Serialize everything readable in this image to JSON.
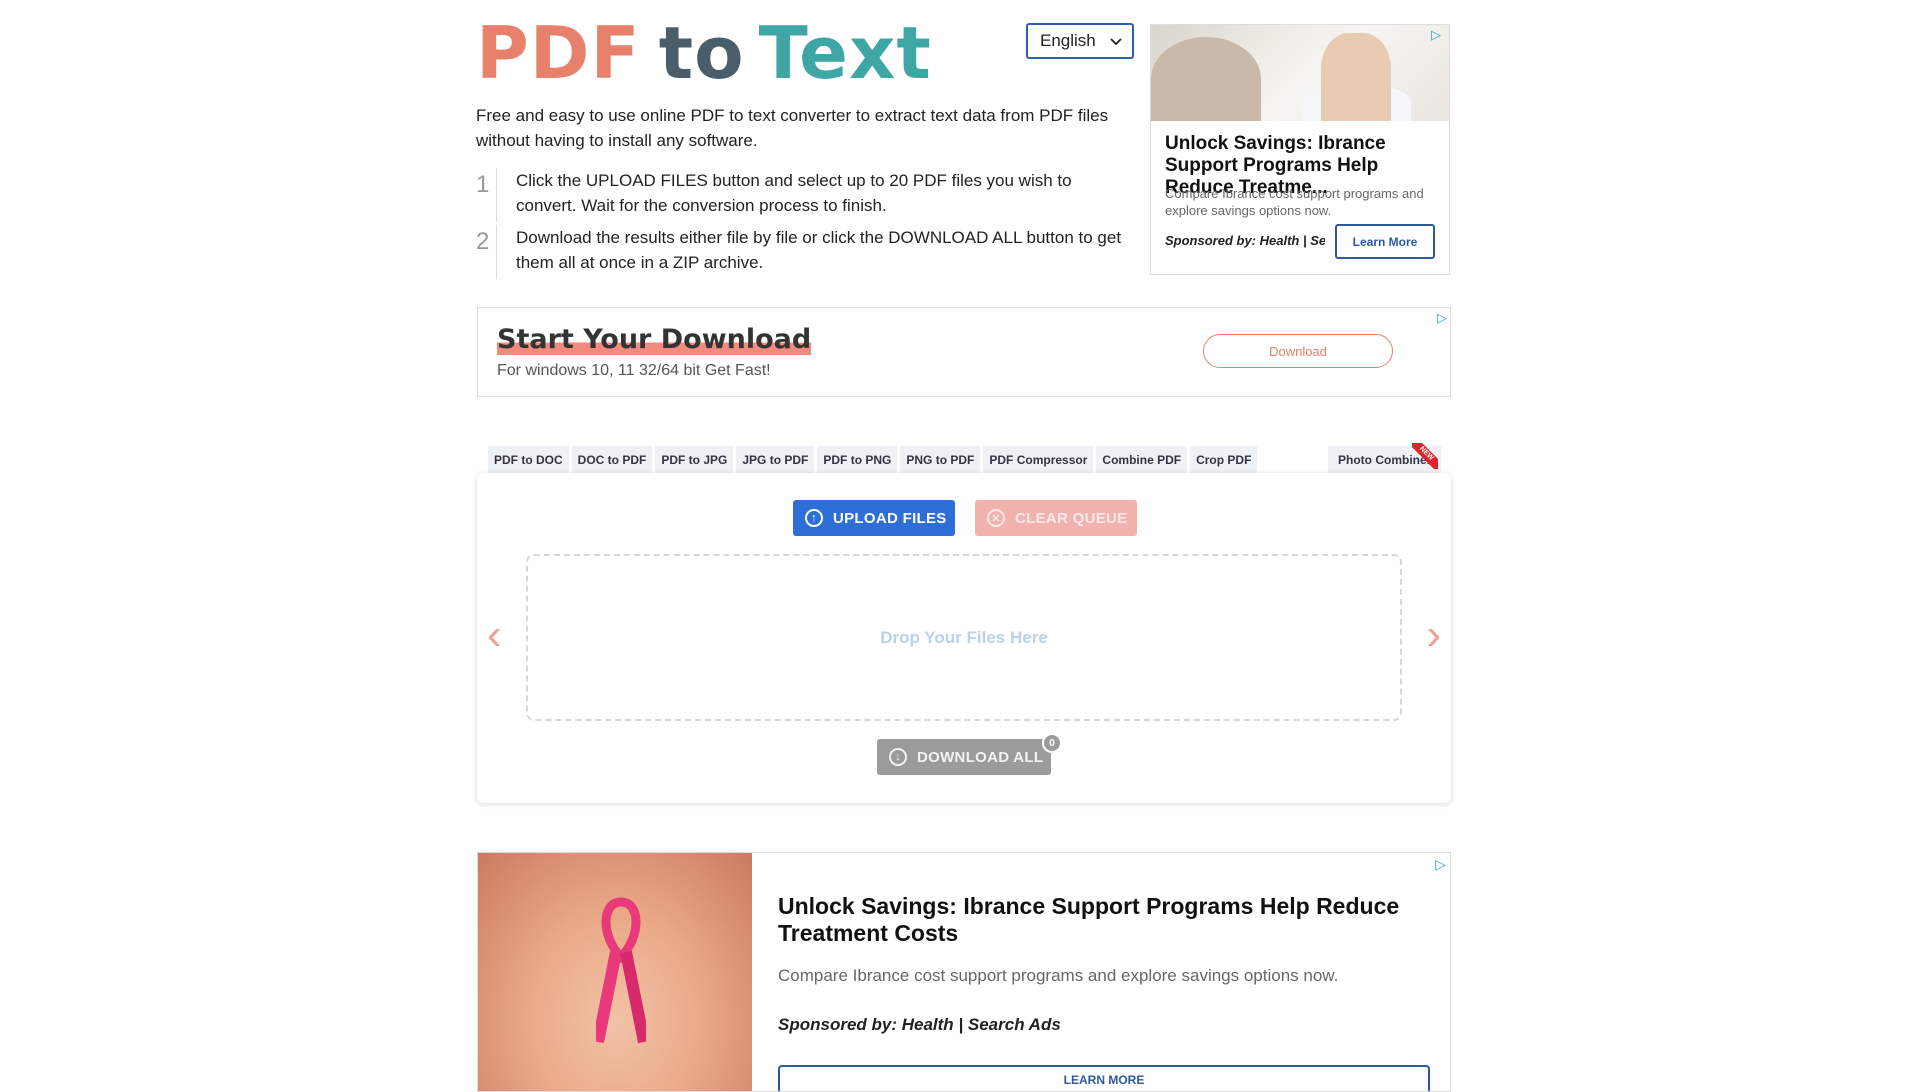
{
  "logo": {
    "part1": "PDF",
    "part2": "to",
    "part3": "Text"
  },
  "language": {
    "selected": "English"
  },
  "intro": "Free and easy to use online PDF to text converter to extract text data from PDF files without having to install any software.",
  "steps": [
    {
      "num": "1",
      "text": "Click the UPLOAD FILES button and select up to 20 PDF files you wish to convert. Wait for the conversion process to finish."
    },
    {
      "num": "2",
      "text": "Download the results either file by file or click the DOWNLOAD ALL button to get them all at once in a ZIP archive."
    }
  ],
  "ad_right": {
    "title": "Unlock Savings: Ibrance Support Programs Help Reduce Treatme...",
    "desc": "Compare Ibrance cost support programs and explore savings options now.",
    "sponsor": "Sponsored by: Health | Sea...",
    "button": "Learn More"
  },
  "ad_banner": {
    "headline": "Start Your Download",
    "sub": "For windows 10, 11 32/64 bit Get Fast!",
    "button": "Download"
  },
  "tabs": [
    "PDF to DOC",
    "DOC to PDF",
    "PDF to JPG",
    "JPG to PDF",
    "PDF to PNG",
    "PNG to PDF",
    "PDF Compressor",
    "Combine PDF",
    "Crop PDF"
  ],
  "tab_photo": "Photo Combiner",
  "tab_photo_badge": "NEW",
  "panel": {
    "upload": "UPLOAD FILES",
    "clear": "CLEAR QUEUE",
    "drop": "Drop Your Files Here",
    "download_all": "DOWNLOAD ALL",
    "count": "0",
    "arrow_left": "‹",
    "arrow_right": "›"
  },
  "ad_bottom": {
    "title": "Unlock Savings: Ibrance Support Programs Help Reduce Treatment Costs",
    "desc": "Compare Ibrance cost support programs and explore savings options now.",
    "sponsor": "Sponsored by: Health | Search Ads",
    "button": "LEARN MORE"
  },
  "colors": {
    "primary": "#2d6fd6",
    "accent": "#e8816c",
    "teal": "#3fa6a6"
  }
}
